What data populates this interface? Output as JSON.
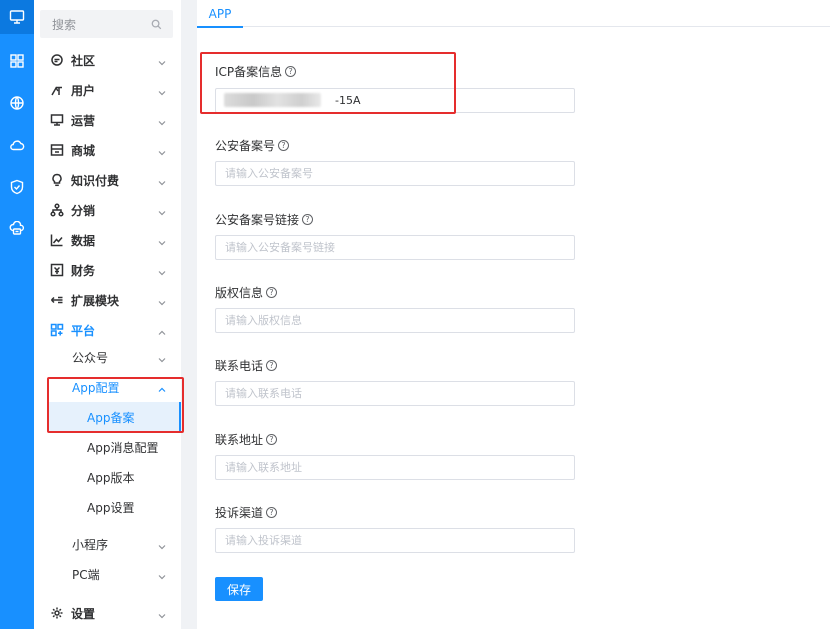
{
  "sidebar": {
    "search_label": "搜索",
    "menu": [
      {
        "label": "社区",
        "icon": "chat-icon"
      },
      {
        "label": "用户",
        "icon": "users-icon"
      },
      {
        "label": "运营",
        "icon": "monitor-icon"
      },
      {
        "label": "商城",
        "icon": "store-icon"
      },
      {
        "label": "知识付费",
        "icon": "bulb-icon"
      },
      {
        "label": "分销",
        "icon": "network-icon"
      },
      {
        "label": "数据",
        "icon": "line-chart-icon"
      },
      {
        "label": "财务",
        "icon": "finance-icon"
      },
      {
        "label": "扩展模块",
        "icon": "extension-icon"
      },
      {
        "label": "平台",
        "icon": "platform-icon"
      }
    ],
    "platform_sub": {
      "wechat_label": "公众号",
      "app_config_label": "App配置",
      "leaves": [
        "App备案",
        "App消息配置",
        "App版本",
        "App设置"
      ],
      "miniprogram_label": "小程序",
      "pc_label": "PC端"
    },
    "settings_label": "设置"
  },
  "main": {
    "tab_label": "APP",
    "fields": [
      {
        "label": "ICP备案信息",
        "value": "-15A",
        "placeholder": ""
      },
      {
        "label": "公安备案号",
        "value": "",
        "placeholder": "请输入公安备案号"
      },
      {
        "label": "公安备案号链接",
        "value": "",
        "placeholder": "请输入公安备案号链接"
      },
      {
        "label": "版权信息",
        "value": "",
        "placeholder": "请输入版权信息"
      },
      {
        "label": "联系电话",
        "value": "",
        "placeholder": "请输入联系电话"
      },
      {
        "label": "联系地址",
        "value": "",
        "placeholder": "请输入联系地址"
      },
      {
        "label": "投诉渠道",
        "value": "",
        "placeholder": "请输入投诉渠道"
      }
    ],
    "help_glyph": "?",
    "save_label": "保存"
  },
  "colors": {
    "accent": "#1890ff",
    "annotation": "#e52d2d",
    "text": "#303133",
    "placeholder": "#c0c4cc"
  }
}
